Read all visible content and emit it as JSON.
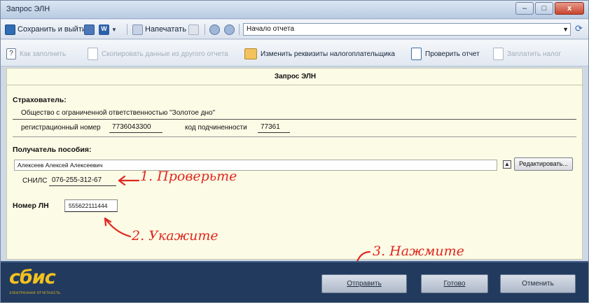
{
  "window": {
    "title": "Запрос ЭЛН",
    "controls": {
      "minimize": "–",
      "maximize": "□",
      "close": "x"
    }
  },
  "toolbar1": {
    "save_exit_label": "Сохранить и выйти",
    "print_label": "Напечатать",
    "combo_value": "Начало отчета"
  },
  "toolbar2": {
    "how_to_fill": "Как заполнить",
    "copy_from_other": "Скопировать данные из другого отчета",
    "change_requisites": "Изменить реквизиты налогоплательщика",
    "check_report": "Проверить отчет",
    "pay_tax": "Заплатить налог"
  },
  "form": {
    "title": "Запрос ЭЛН",
    "insurer_label": "Страхователь:",
    "org_name": "Общество с ограниченной ответственностью \"Золотое дно\"",
    "reg_number_label": "регистрационный номер",
    "reg_number": "7736043300",
    "sub_code_label": "код подчиненности",
    "sub_code": "77361",
    "recipient_label": "Получатель пособия:",
    "recipient_name": "Алексеев Алексей Алексеевич",
    "edit_button": "Редактировать...",
    "snils_label": "СНИЛС",
    "snils": "076-255-312-67",
    "ln_label": "Номер ЛН",
    "ln_number": "555622111444"
  },
  "annotations": {
    "check": "1. Проверьте",
    "enter": "2. Укажите",
    "press": "3. Нажмите"
  },
  "footer": {
    "logo": "сбис",
    "logo_sub": "ЭЛЕКТРОННАЯ ОТЧЕТНОСТЬ",
    "send_button": "Отправить",
    "done_button": "Готово",
    "cancel_button": "Отменить"
  },
  "colors": {
    "annotation": "#e0281e",
    "footer_bg": "#223a5e",
    "logo": "#f3c21e",
    "form_bg": "#fbfbe6"
  }
}
